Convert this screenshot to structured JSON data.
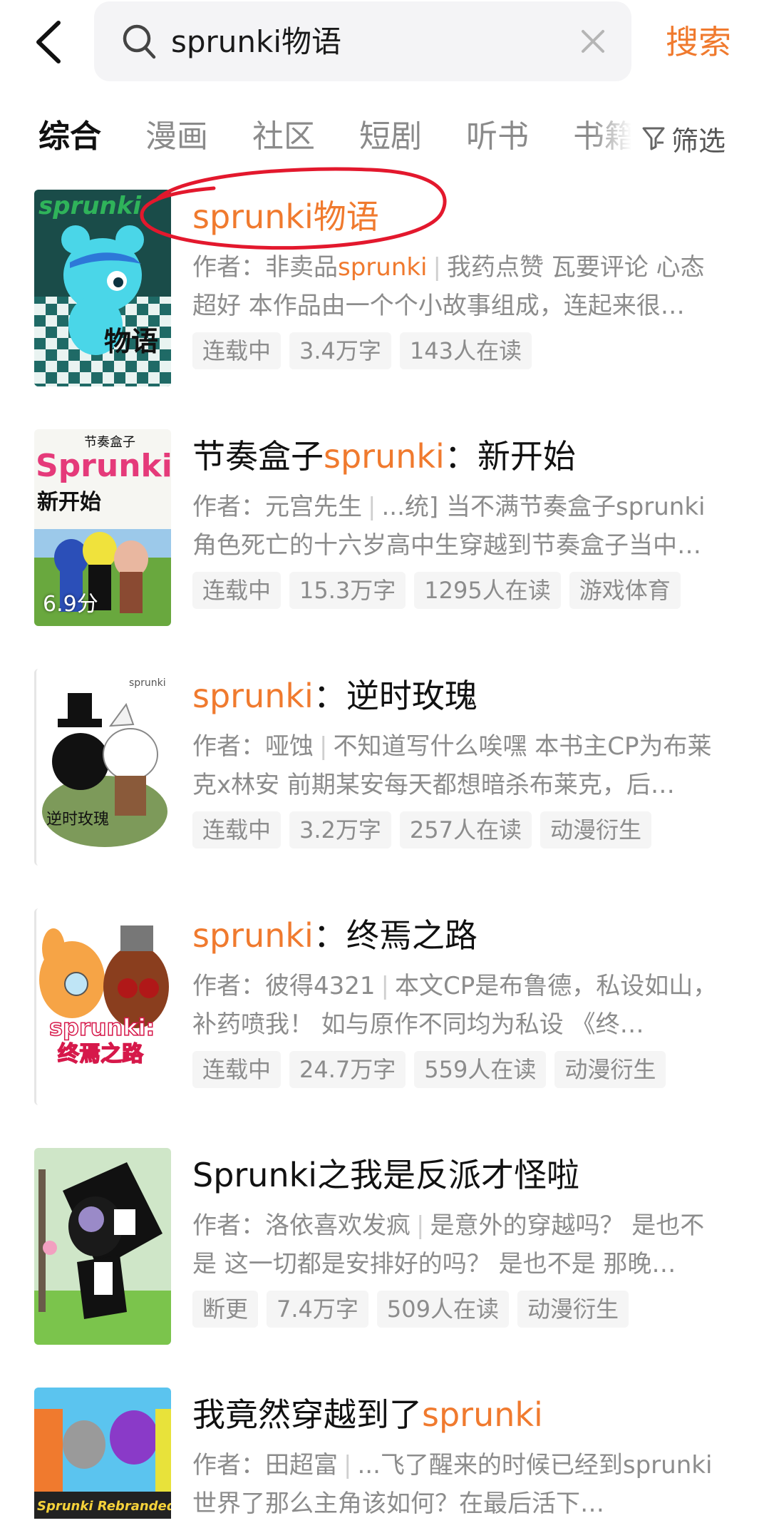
{
  "header": {
    "query": "sprunki物语",
    "search_button": "搜索"
  },
  "tabs": [
    "综合",
    "漫画",
    "社区",
    "短剧",
    "听书",
    "书籍"
  ],
  "filter_label": "筛选",
  "results": [
    {
      "title_parts": [
        {
          "t": "sprunki物语",
          "hl": true
        }
      ],
      "author_prefix": "作者：非卖品",
      "author_hl": "sprunki",
      "author_suffix": "",
      "desc": "我药点赞 瓦要评论 心态超好 本作品由一个个小故事组成，连起来很…",
      "tags": [
        "连载中",
        "3.4万字",
        "143人在读"
      ],
      "score": ""
    },
    {
      "title_parts": [
        {
          "t": "节奏盒子",
          "hl": false
        },
        {
          "t": "sprunki",
          "hl": true
        },
        {
          "t": "：新开始",
          "hl": false
        }
      ],
      "author_prefix": "作者：元宫先生",
      "author_hl": "",
      "author_suffix": "",
      "desc": "...统] 当不满节奏盒子sprunki角色死亡的十六岁高中生穿越到节奏盒子当中…",
      "tags": [
        "连载中",
        "15.3万字",
        "1295人在读",
        "游戏体育"
      ],
      "score": "6.9分"
    },
    {
      "title_parts": [
        {
          "t": "sprunki",
          "hl": true
        },
        {
          "t": "：逆时玫瑰",
          "hl": false
        }
      ],
      "author_prefix": "作者：哑蚀",
      "author_hl": "",
      "author_suffix": "",
      "desc": "不知道写什么唉嘿 本书主CP为布莱克x林安 前期某安每天都想暗杀布莱克，后…",
      "tags": [
        "连载中",
        "3.2万字",
        "257人在读",
        "动漫衍生"
      ],
      "score": ""
    },
    {
      "title_parts": [
        {
          "t": "sprunki",
          "hl": true
        },
        {
          "t": "：终焉之路",
          "hl": false
        }
      ],
      "author_prefix": "作者：彼得4321",
      "author_hl": "",
      "author_suffix": "",
      "desc": "本文CP是布鲁德，私设如山，补药喷我！ 如与原作不同均为私设 《终…",
      "tags": [
        "连载中",
        "24.7万字",
        "559人在读",
        "动漫衍生"
      ],
      "score": ""
    },
    {
      "title_parts": [
        {
          "t": "Sprunki之我是反派才怪啦",
          "hl": false
        }
      ],
      "author_prefix": "作者：洛依喜欢发疯",
      "author_hl": "",
      "author_suffix": "",
      "desc": "是意外的穿越吗？ 是也不是 这一切都是安排好的吗？ 是也不是 那晚…",
      "tags": [
        "断更",
        "7.4万字",
        "509人在读",
        "动漫衍生"
      ],
      "score": ""
    },
    {
      "title_parts": [
        {
          "t": "我竟然穿越到了",
          "hl": false
        },
        {
          "t": "sprunki",
          "hl": true
        }
      ],
      "author_prefix": "作者：田超富",
      "author_hl": "",
      "author_suffix": "",
      "desc": "...飞了醒来的时候已经到sprunki世界了那么主角该如何？在最后活下…",
      "tags": [],
      "score": ""
    }
  ],
  "cover_texts": {
    "c1_top": "sprunki",
    "c1_bottom": "物语",
    "c2_small": "节奏盒子",
    "c2_big": "Sprunki",
    "c2_sub": "新开始",
    "c3": "逆时玫瑰",
    "c3_corner": "sprunki",
    "c4a": "sprunki:",
    "c4b": "终焉之路",
    "c6": "Sprunki Rebranded"
  },
  "colors": {
    "accent": "#f07a2e",
    "annotation": "#e3182d"
  }
}
